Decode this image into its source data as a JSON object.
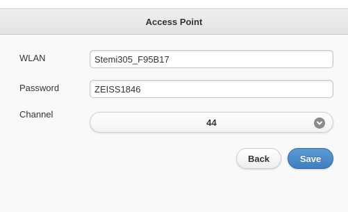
{
  "header": {
    "title": "Access Point"
  },
  "form": {
    "wlan": {
      "label": "WLAN",
      "value": "Stemi305_F95B17"
    },
    "password": {
      "label": "Password",
      "value": "ZEISS1846"
    },
    "channel": {
      "label": "Channel",
      "value": "44",
      "icon": "chevron-down-circle-icon"
    }
  },
  "buttons": {
    "back_label": "Back",
    "save_label": "Save"
  },
  "colors": {
    "save_button": "#4a8cc9",
    "header_bg": "#e8e8e8",
    "content_bg": "#f9f9f9"
  }
}
